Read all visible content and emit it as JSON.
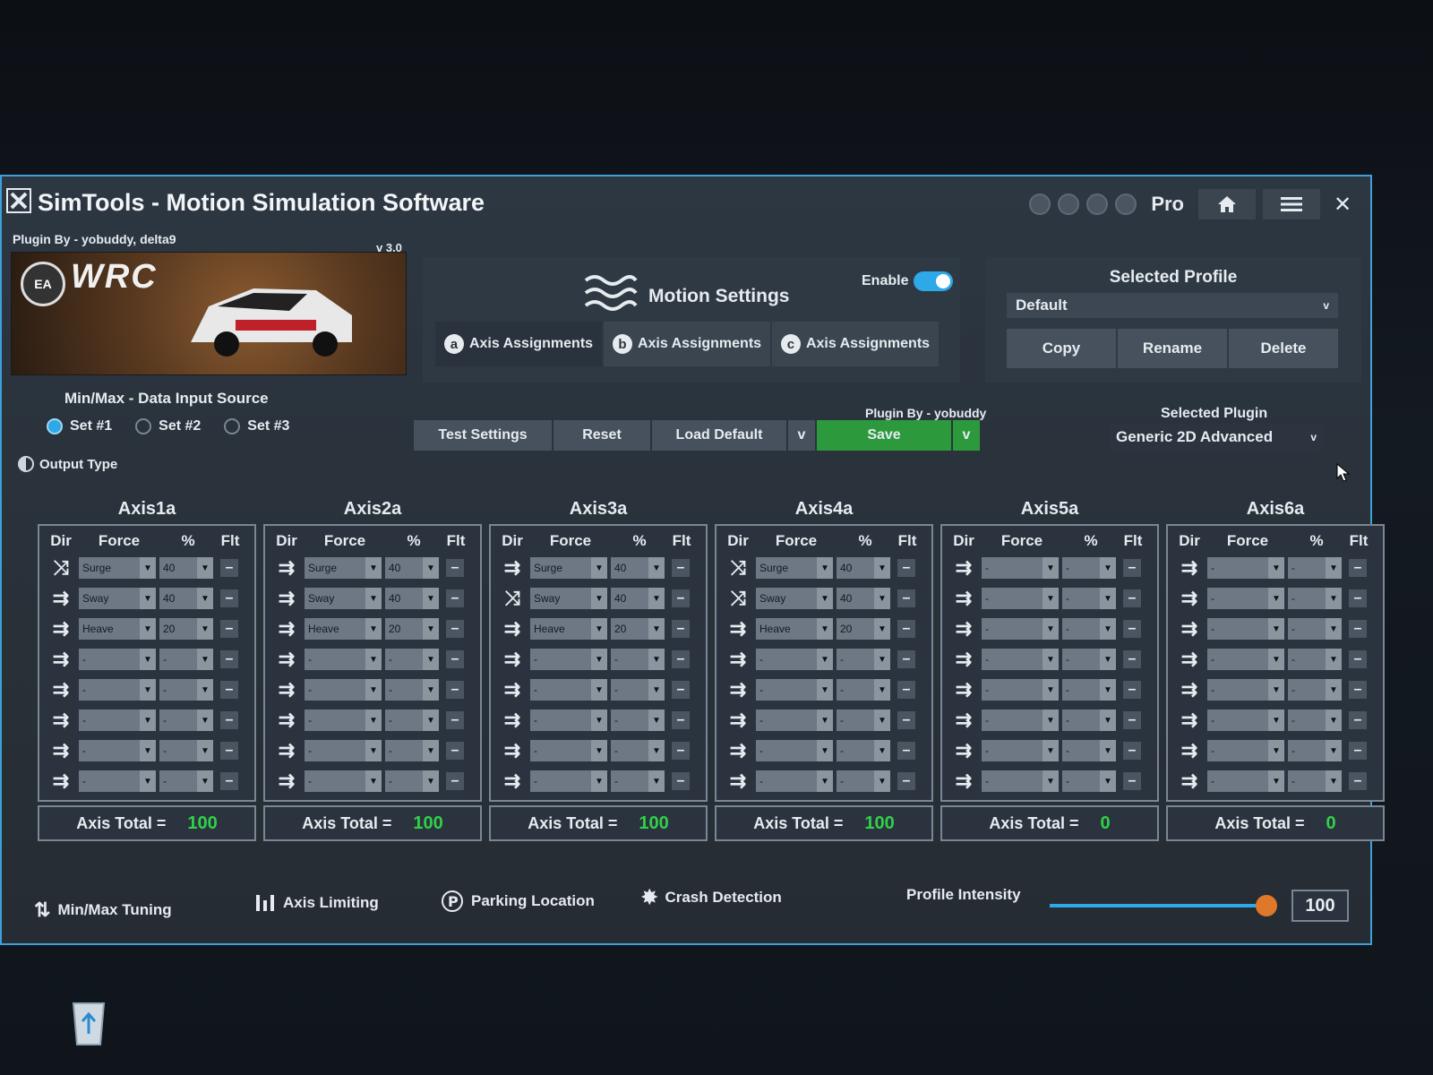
{
  "window": {
    "title": "SimTools - Motion Simulation Software",
    "edition": "Pro",
    "close_label": "✕"
  },
  "banner": {
    "plugin_by": "Plugin By - yobuddy, delta9",
    "version": "v 3.0",
    "ea_logo": "EA",
    "game_logo": "WRC"
  },
  "motion": {
    "title": "Motion Settings",
    "enable_label": "Enable",
    "enabled": true,
    "tabs": [
      {
        "badge": "a",
        "label": "Axis Assignments"
      },
      {
        "badge": "b",
        "label": "Axis Assignments"
      },
      {
        "badge": "c",
        "label": "Axis Assignments"
      }
    ]
  },
  "profile": {
    "title": "Selected Profile",
    "value": "Default",
    "copy": "Copy",
    "rename": "Rename",
    "delete": "Delete"
  },
  "input_source": {
    "title": "Min/Max - Data Input Source",
    "sets": [
      "Set #1",
      "Set #2",
      "Set #3"
    ],
    "selected": 0,
    "output_type": "Output Type"
  },
  "actions": {
    "test": "Test Settings",
    "reset": "Reset",
    "load_default": "Load Default",
    "dropdown": "v",
    "plugin_by": "Plugin By - yobuddy",
    "save": "Save",
    "selected_plugin_title": "Selected Plugin",
    "selected_plugin": "Generic 2D Advanced",
    "chevron": "v"
  },
  "axis_columns": {
    "dir": "Dir",
    "force": "Force",
    "pct": "%",
    "flt": "Flt"
  },
  "axis_total_label": "Axis Total =",
  "axes": [
    {
      "name": "Axis1a",
      "total": "100",
      "rows": [
        {
          "dir": "mixed",
          "force": "Surge",
          "pct": "40"
        },
        {
          "dir": "straight",
          "force": "Sway",
          "pct": "40"
        },
        {
          "dir": "straight",
          "force": "Heave",
          "pct": "20"
        },
        {
          "dir": "straight",
          "force": "-",
          "pct": "-"
        },
        {
          "dir": "straight",
          "force": "-",
          "pct": "-"
        },
        {
          "dir": "straight",
          "force": "-",
          "pct": "-"
        },
        {
          "dir": "straight",
          "force": "-",
          "pct": "-"
        },
        {
          "dir": "straight",
          "force": "-",
          "pct": "-"
        }
      ]
    },
    {
      "name": "Axis2a",
      "total": "100",
      "rows": [
        {
          "dir": "straight",
          "force": "Surge",
          "pct": "40"
        },
        {
          "dir": "straight",
          "force": "Sway",
          "pct": "40"
        },
        {
          "dir": "straight",
          "force": "Heave",
          "pct": "20"
        },
        {
          "dir": "straight",
          "force": "-",
          "pct": "-"
        },
        {
          "dir": "straight",
          "force": "-",
          "pct": "-"
        },
        {
          "dir": "straight",
          "force": "-",
          "pct": "-"
        },
        {
          "dir": "straight",
          "force": "-",
          "pct": "-"
        },
        {
          "dir": "straight",
          "force": "-",
          "pct": "-"
        }
      ]
    },
    {
      "name": "Axis3a",
      "total": "100",
      "rows": [
        {
          "dir": "straight",
          "force": "Surge",
          "pct": "40"
        },
        {
          "dir": "mixed",
          "force": "Sway",
          "pct": "40"
        },
        {
          "dir": "straight",
          "force": "Heave",
          "pct": "20"
        },
        {
          "dir": "straight",
          "force": "-",
          "pct": "-"
        },
        {
          "dir": "straight",
          "force": "-",
          "pct": "-"
        },
        {
          "dir": "straight",
          "force": "-",
          "pct": "-"
        },
        {
          "dir": "straight",
          "force": "-",
          "pct": "-"
        },
        {
          "dir": "straight",
          "force": "-",
          "pct": "-"
        }
      ]
    },
    {
      "name": "Axis4a",
      "total": "100",
      "rows": [
        {
          "dir": "mixed",
          "force": "Surge",
          "pct": "40"
        },
        {
          "dir": "mixed",
          "force": "Sway",
          "pct": "40"
        },
        {
          "dir": "straight",
          "force": "Heave",
          "pct": "20"
        },
        {
          "dir": "straight",
          "force": "-",
          "pct": "-"
        },
        {
          "dir": "straight",
          "force": "-",
          "pct": "-"
        },
        {
          "dir": "straight",
          "force": "-",
          "pct": "-"
        },
        {
          "dir": "straight",
          "force": "-",
          "pct": "-"
        },
        {
          "dir": "straight",
          "force": "-",
          "pct": "-"
        }
      ]
    },
    {
      "name": "Axis5a",
      "total": "0",
      "rows": [
        {
          "dir": "straight",
          "force": "-",
          "pct": "-"
        },
        {
          "dir": "straight",
          "force": "-",
          "pct": "-"
        },
        {
          "dir": "straight",
          "force": "-",
          "pct": "-"
        },
        {
          "dir": "straight",
          "force": "-",
          "pct": "-"
        },
        {
          "dir": "straight",
          "force": "-",
          "pct": "-"
        },
        {
          "dir": "straight",
          "force": "-",
          "pct": "-"
        },
        {
          "dir": "straight",
          "force": "-",
          "pct": "-"
        },
        {
          "dir": "straight",
          "force": "-",
          "pct": "-"
        }
      ]
    },
    {
      "name": "Axis6a",
      "total": "0",
      "rows": [
        {
          "dir": "straight",
          "force": "-",
          "pct": "-"
        },
        {
          "dir": "straight",
          "force": "-",
          "pct": "-"
        },
        {
          "dir": "straight",
          "force": "-",
          "pct": "-"
        },
        {
          "dir": "straight",
          "force": "-",
          "pct": "-"
        },
        {
          "dir": "straight",
          "force": "-",
          "pct": "-"
        },
        {
          "dir": "straight",
          "force": "-",
          "pct": "-"
        },
        {
          "dir": "straight",
          "force": "-",
          "pct": "-"
        },
        {
          "dir": "straight",
          "force": "-",
          "pct": "-"
        }
      ]
    }
  ],
  "bottom": {
    "minmax": "Min/Max Tuning",
    "limiting": "Axis Limiting",
    "parking": "Parking Location",
    "crash": "Crash Detection",
    "intensity_label": "Profile Intensity",
    "intensity_value": "100",
    "intensity_fraction": 1.0
  },
  "colors": {
    "accent": "#2da8e8",
    "save": "#2c9a3c",
    "total": "#32d04a",
    "thumb": "#e0782a"
  }
}
